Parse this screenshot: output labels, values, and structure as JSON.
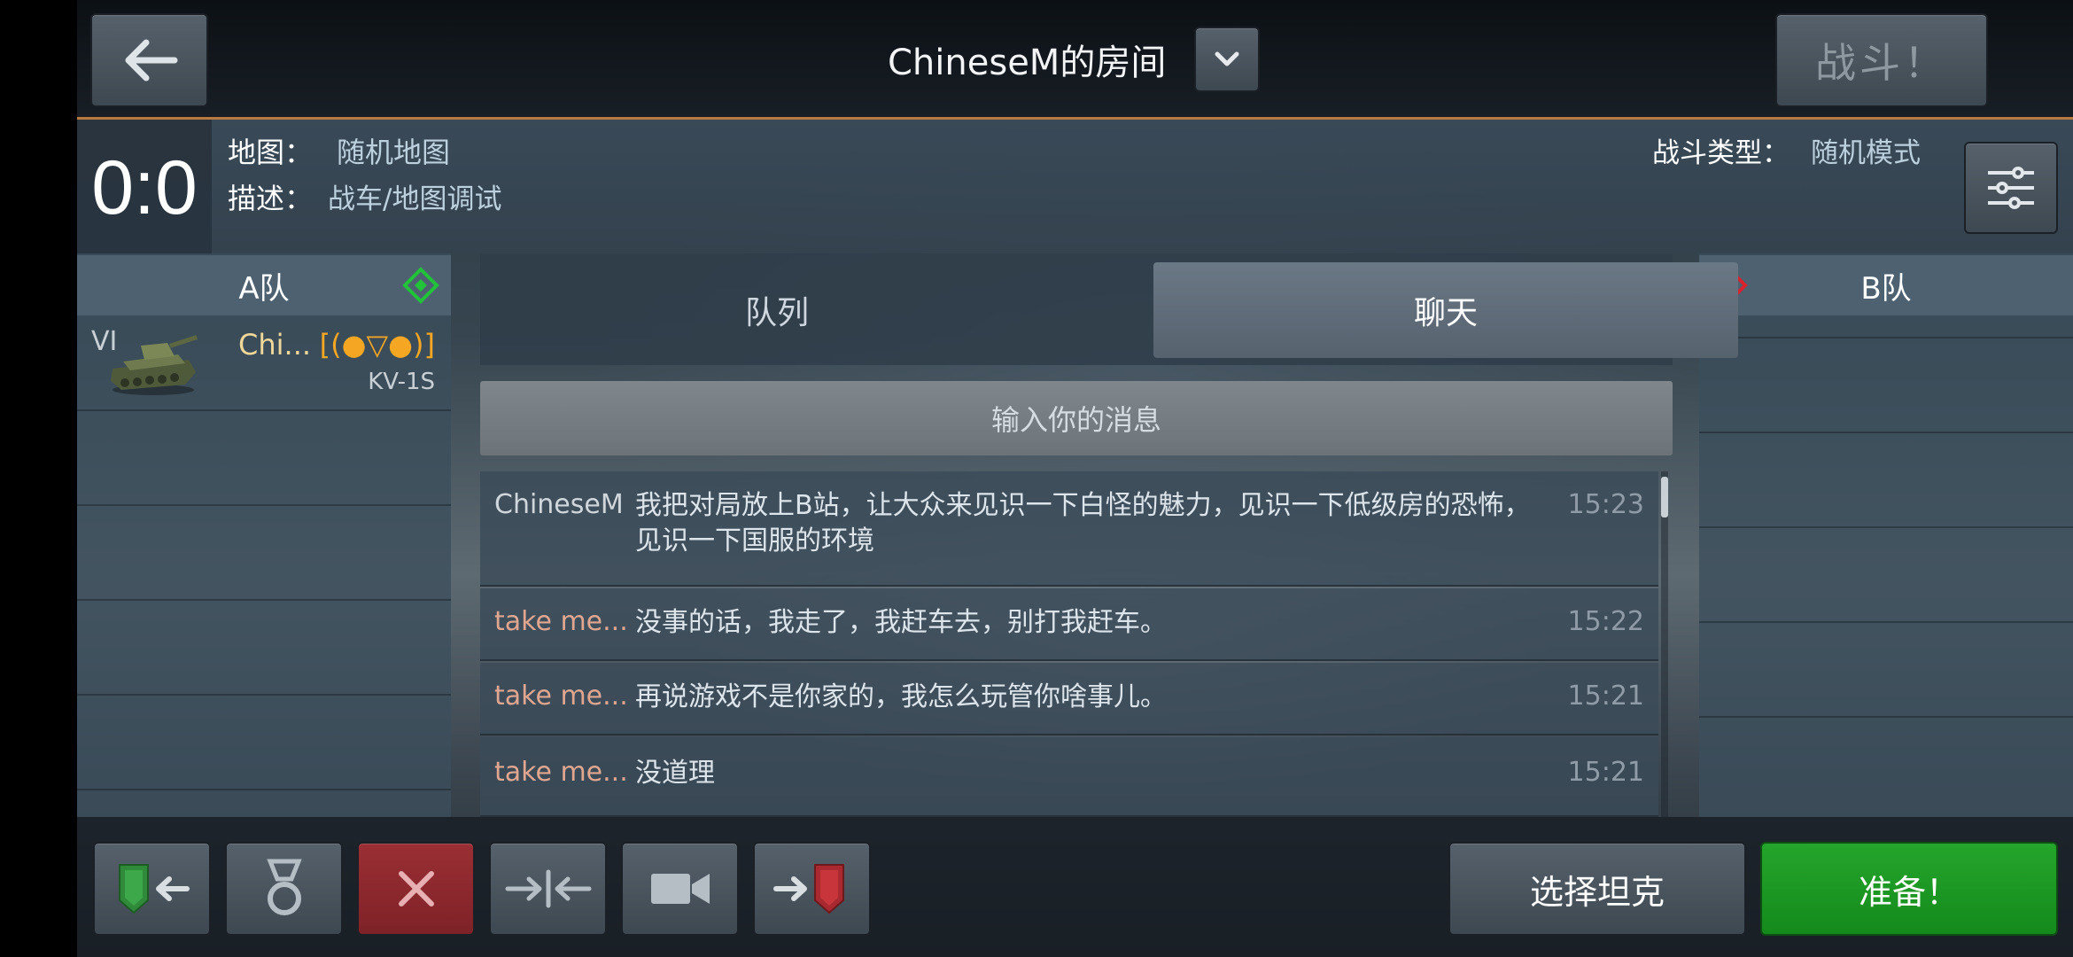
{
  "header": {
    "room_title": "ChineseM的房间",
    "fight_label": "战斗！"
  },
  "info": {
    "score": "0:0",
    "map_label": "地图：",
    "map_value": "随机地图",
    "desc_label": "描述：",
    "desc_value": "战车/地图调试",
    "battle_type_label": "战斗类型：",
    "battle_type_value": "随机模式"
  },
  "team_a": {
    "name": "A队",
    "players": [
      {
        "tier": "VI",
        "name": "Chi...",
        "clan": "[(●▽●)]",
        "tank": "KV-1S"
      }
    ]
  },
  "team_b": {
    "name": "B队"
  },
  "tabs": {
    "queue": "队列",
    "chat": "聊天"
  },
  "chat": {
    "input_placeholder": "输入你的消息",
    "messages": [
      {
        "user": "ChineseM",
        "text_line1": "我把对局放上B站，让大众来见识一下白怪的魅力，见识一下低级房的恐怖，",
        "text_line2": "见识一下国服的环境",
        "time": "15:23"
      },
      {
        "user": "take  me...",
        "text": "没事的话，我走了，我赶车去，别打我赶车。",
        "time": "15:22"
      },
      {
        "user": "take  me...",
        "text": "再说游戏不是你家的，我怎么玩管你啥事儿。",
        "time": "15:21"
      },
      {
        "user": "take  me...",
        "text": "没道理",
        "time": "15:21"
      }
    ]
  },
  "bottom": {
    "select_tank": "选择坦克",
    "ready": "准备！"
  },
  "colors": {
    "accent_orange": "#b87a3e",
    "team_a_marker": "#22c33a",
    "team_b_marker": "#d9232e",
    "ready_green": "#1a9a22",
    "user_own": "#cfd6dc",
    "user_other": "#e0a690"
  },
  "icons": [
    "back-arrow-icon",
    "chevron-down-icon",
    "sliders-icon",
    "team-a-diamond-icon",
    "team-b-diamond-icon",
    "tank-icon",
    "exit-team-icon",
    "medal-icon",
    "close-icon",
    "merge-arrows-icon",
    "camera-icon",
    "enter-team-icon"
  ]
}
